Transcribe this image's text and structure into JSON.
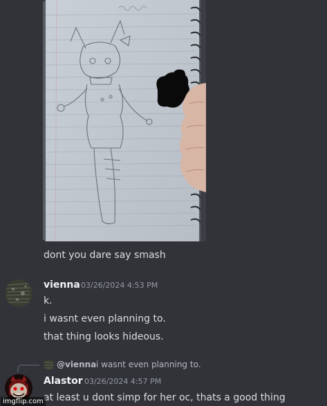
{
  "attachment": {
    "credit_text": "",
    "watermark_text": "imgflip.com"
  },
  "messages": [
    {
      "id": "msg-prev",
      "lines": [
        "dont you dare say smash"
      ]
    },
    {
      "id": "msg-vienna",
      "author": "vienna",
      "timestamp": "03/26/2024 4:53 PM",
      "lines": [
        "k.",
        "i wasnt even planning to.",
        "that thing looks hideous."
      ]
    },
    {
      "id": "msg-alastor",
      "author": "Alastor",
      "timestamp": "03/26/2024 4:57 PM",
      "reply_to": {
        "author": "@vienna",
        "snippet": "i wasnt even planning to."
      },
      "lines": [
        "at least u dont simp for her oc, thats a good thing"
      ]
    }
  ],
  "colors": {
    "background": "#313338",
    "text": "#dbdee1",
    "author": "#f2f3f5",
    "timestamp": "#949ba4",
    "muted": "#b5bac1"
  },
  "icons": {
    "vienna_avatar": "vienna-avatar",
    "alastor_avatar": "alastor-avatar",
    "reply_avatar": "reply-avatar-icon"
  }
}
